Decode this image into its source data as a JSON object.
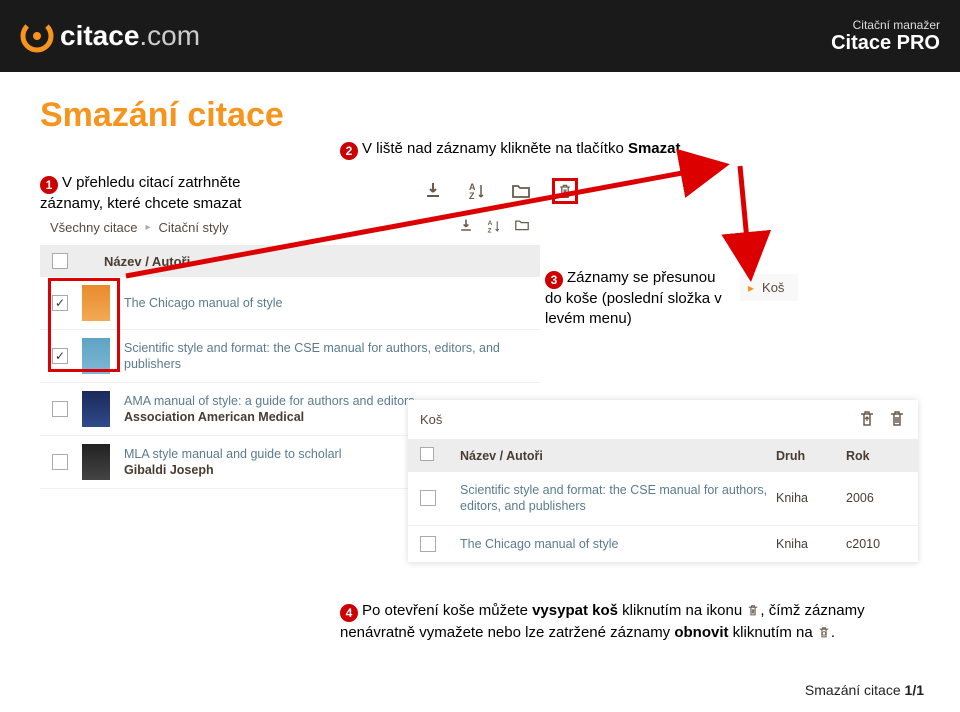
{
  "header": {
    "logo_main": "citace",
    "logo_dom": ".com",
    "tagline": "Citační manažer",
    "product": "Citace PRO"
  },
  "title": "Smazání citace",
  "steps": {
    "s1": "V přehledu citací zatrhněte záznamy, které chcete smazat",
    "s2_pre": "V liště nad záznamy klikněte na tlačítko ",
    "s2_bold": "Smazat",
    "s3": "Záznamy se přesunou do koše (poslední složka v levém menu)",
    "s4_pre": "Po otevření koše můžete ",
    "s4_b1": "vysypat koš",
    "s4_mid": " kliknutím na ikonu ",
    "s4_mid2": ", čímž záznamy nenávratně vymažete nebo lze zatržené záznamy ",
    "s4_b2": "obnovit",
    "s4_end": " kliknutím na ",
    "s4_dot": "."
  },
  "panel1": {
    "bc1": "Všechny citace",
    "bc2": "Citační styly",
    "hdr": "Název / Autoři",
    "rows": [
      {
        "checked": true,
        "thumb": "orange",
        "t1": "The Chicago manual of style",
        "t2": ""
      },
      {
        "checked": true,
        "thumb": "blue",
        "t1": "Scientific style and format: the CSE manual for authors, editors, and publishers",
        "t2": ""
      },
      {
        "checked": false,
        "thumb": "navy",
        "t1": "AMA manual of style: a guide for authors and editors",
        "t2": "Association American Medical"
      },
      {
        "checked": false,
        "thumb": "dark",
        "t1": "MLA style manual and guide to scholarl",
        "t2": "Gibaldi Joseph"
      }
    ]
  },
  "kos_label": "Koš",
  "panel2": {
    "title": "Koš",
    "col_name": "Název / Autoři",
    "col_type": "Druh",
    "col_year": "Rok",
    "rows": [
      {
        "name": "Scientific style and format: the CSE manual for authors, editors, and publishers",
        "type": "Kniha",
        "year": "2006"
      },
      {
        "name": "The Chicago manual of style",
        "type": "Kniha",
        "year": "c2010"
      }
    ]
  },
  "footer": {
    "label": "Smazání citace ",
    "page": "1/1"
  }
}
